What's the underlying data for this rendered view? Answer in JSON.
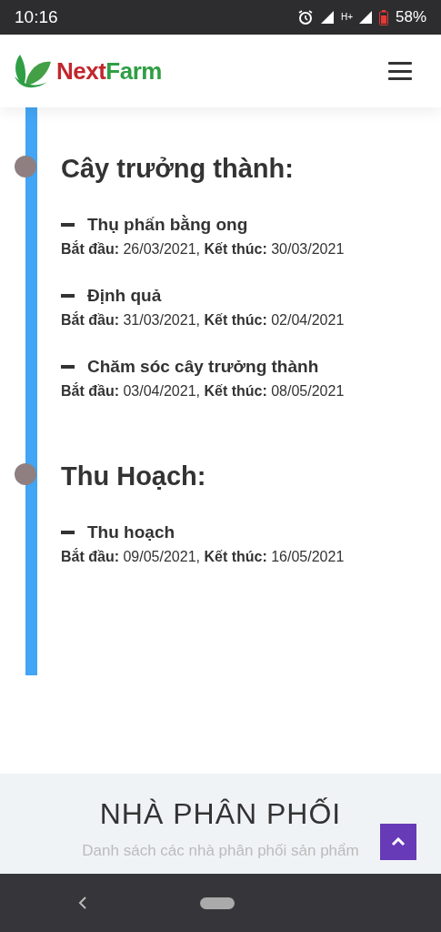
{
  "status_bar": {
    "time": "10:16",
    "network": "H+",
    "battery": "58%"
  },
  "header": {
    "logo_first": "Next",
    "logo_second": "Farm"
  },
  "timeline": [
    {
      "title": "Cây trưởng thành:",
      "tasks": [
        {
          "name": "Thụ phấn bằng ong",
          "dates": "**Bắt đầu:** 26/03/2021, **Kết thúc:** 30/03/2021"
        },
        {
          "name": "Định quả",
          "dates": "**Bắt đầu:** 31/03/2021, **Kết thúc:** 02/04/2021"
        },
        {
          "name": "Chăm sóc cây trưởng thành",
          "dates": "**Bắt đầu:** 03/04/2021, **Kết thúc:** 08/05/2021"
        }
      ]
    },
    {
      "title": "Thu Hoạch:",
      "tasks": [
        {
          "name": "Thu hoạch",
          "dates": "**Bắt đầu:** 09/05/2021, **Kết thúc:** 16/05/2021"
        }
      ]
    }
  ],
  "distributors": {
    "title": "NHÀ PHÂN PHỐI",
    "subtitle": "Danh sách các nhà phân phối sản phẩm"
  }
}
